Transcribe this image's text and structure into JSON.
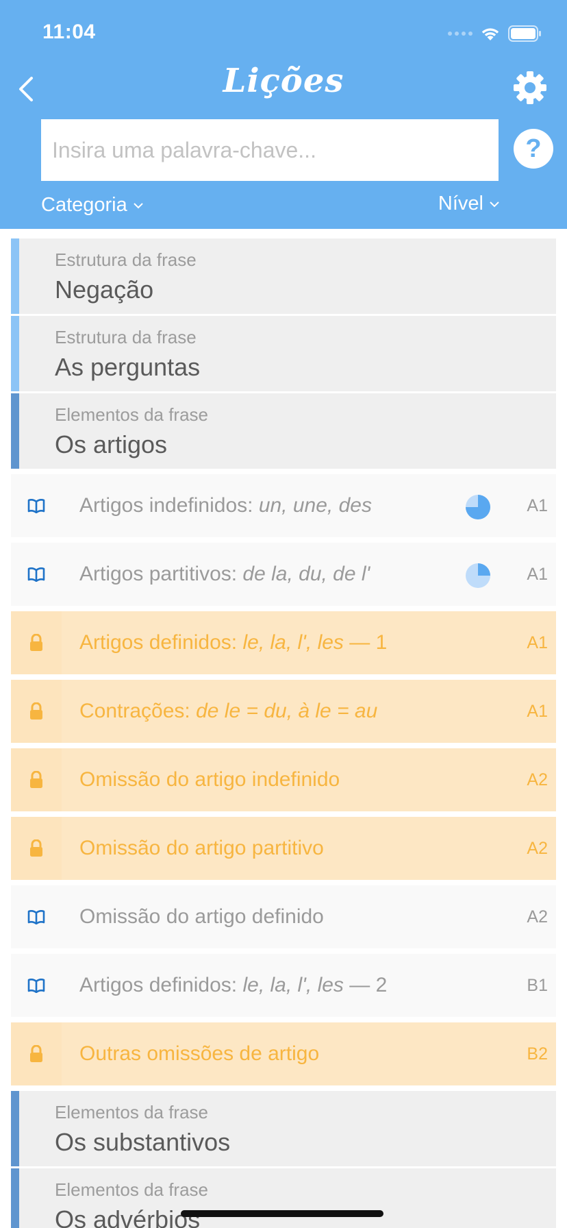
{
  "status_bar": {
    "time": "11:04"
  },
  "header": {
    "title": "Lições",
    "search_placeholder": "Insira uma palavra-chave...",
    "help_label": "?",
    "category_filter": "Categoria",
    "level_filter": "Nível"
  },
  "colors": {
    "header_bg": "#66b0f0",
    "locked_bg": "#fde7c4",
    "locked_text": "#f7b540",
    "book_icon": "#1f73c8",
    "category_bar_light": "#8cc4f6",
    "category_bar_dark": "#5f95cf"
  },
  "categories": {
    "negacao": {
      "subtitle": "Estrutura da frase",
      "title": "Negação"
    },
    "perguntas": {
      "subtitle": "Estrutura da frase",
      "title": "As perguntas"
    },
    "artigos": {
      "subtitle": "Elementos da frase",
      "title": "Os artigos"
    },
    "substantivos": {
      "subtitle": "Elementos da frase",
      "title": "Os substantivos"
    },
    "adverbios": {
      "subtitle": "Elementos da frase",
      "title": "Os advérbios"
    }
  },
  "lessons": [
    {
      "title": "Artigos indefinidos: ",
      "examples": "un, une, des",
      "suffix": "",
      "level": "A1",
      "locked": false,
      "icon": "book-icon",
      "progress": 0.75
    },
    {
      "title": "Artigos partitivos: ",
      "examples": "de la, du, de l'",
      "suffix": "",
      "level": "A1",
      "locked": false,
      "icon": "book-icon",
      "progress": 0.25
    },
    {
      "title": "Artigos definidos: ",
      "examples": "le, la, l', les",
      "suffix": " — 1",
      "level": "A1",
      "locked": true,
      "icon": "lock-icon"
    },
    {
      "title": "Contrações: ",
      "examples": "de le = du, à le = au",
      "suffix": "",
      "level": "A1",
      "locked": true,
      "icon": "lock-icon"
    },
    {
      "title": "Omissão do artigo indefinido",
      "examples": "",
      "suffix": "",
      "level": "A2",
      "locked": true,
      "icon": "lock-icon"
    },
    {
      "title": "Omissão do artigo partitivo",
      "examples": "",
      "suffix": "",
      "level": "A2",
      "locked": true,
      "icon": "lock-icon"
    },
    {
      "title": "Omissão do artigo definido",
      "examples": "",
      "suffix": "",
      "level": "A2",
      "locked": false,
      "icon": "book-icon"
    },
    {
      "title": "Artigos definidos: ",
      "examples": "le, la, l', les",
      "suffix": " — 2",
      "level": "B1",
      "locked": false,
      "icon": "book-icon"
    },
    {
      "title": "Outras omissões de artigo",
      "examples": "",
      "suffix": "",
      "level": "B2",
      "locked": true,
      "icon": "lock-icon"
    }
  ]
}
